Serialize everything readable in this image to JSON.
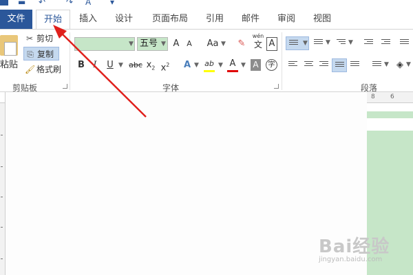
{
  "tabs": {
    "file": "文件",
    "home": "开始",
    "insert": "插入",
    "design": "设计",
    "page_layout": "页面布局",
    "references": "引用",
    "mailings": "邮件",
    "review": "审阅",
    "view": "视图"
  },
  "clipboard": {
    "paste": "粘贴",
    "cut": "剪切",
    "copy": "复制",
    "format_painter": "格式刷",
    "group_label": "剪贴板"
  },
  "font": {
    "font_name": "",
    "font_size": "五号",
    "grow": "A",
    "shrink": "A",
    "change_case": "Aa",
    "phonetic_top": "wén",
    "phonetic_bottom": "文",
    "char_border": "A",
    "bold": "B",
    "italic": "I",
    "underline": "U",
    "strike": "abc",
    "subscript": "x",
    "subscript_small": "2",
    "superscript": "x",
    "superscript_small": "2",
    "text_effect": "A",
    "highlight": "ab",
    "font_color": "A",
    "char_shading": "A",
    "enclose": "字",
    "group_label": "字体"
  },
  "paragraph": {
    "group_label": "段落"
  },
  "ruler": {
    "h_labels": [
      "8",
      "6"
    ]
  },
  "watermark": {
    "text": "Bai经验",
    "url": "jingyan.baidu.com"
  },
  "colors": {
    "accent": "#2b579a",
    "highlight_green": "#c6e6c8",
    "arrow_red": "#e0201c"
  }
}
